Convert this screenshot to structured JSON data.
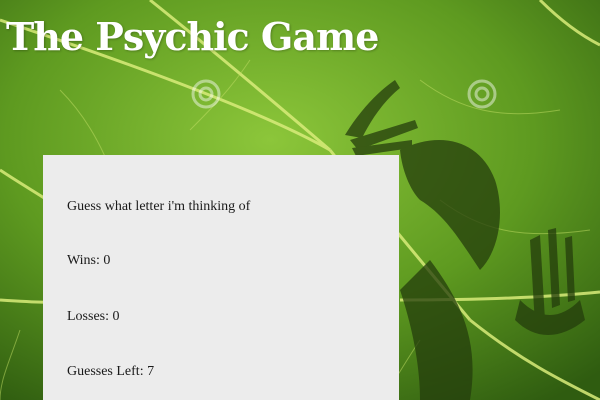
{
  "page": {
    "title": "The Psychic Game"
  },
  "panel": {
    "prompt": "Guess what letter i'm thinking of",
    "wins_label": "Wins:",
    "wins_value": "0",
    "losses_label": "Losses:",
    "losses_value": "0",
    "guesses_left_label": "Guesses Left:",
    "guesses_left_value": "7"
  },
  "colors": {
    "panel_bg": "#ececec",
    "leaf_green": "#4f8a1a",
    "title_color": "#ffffff"
  },
  "icons": {
    "background": "leaf-texture-with-shadow-hands"
  }
}
